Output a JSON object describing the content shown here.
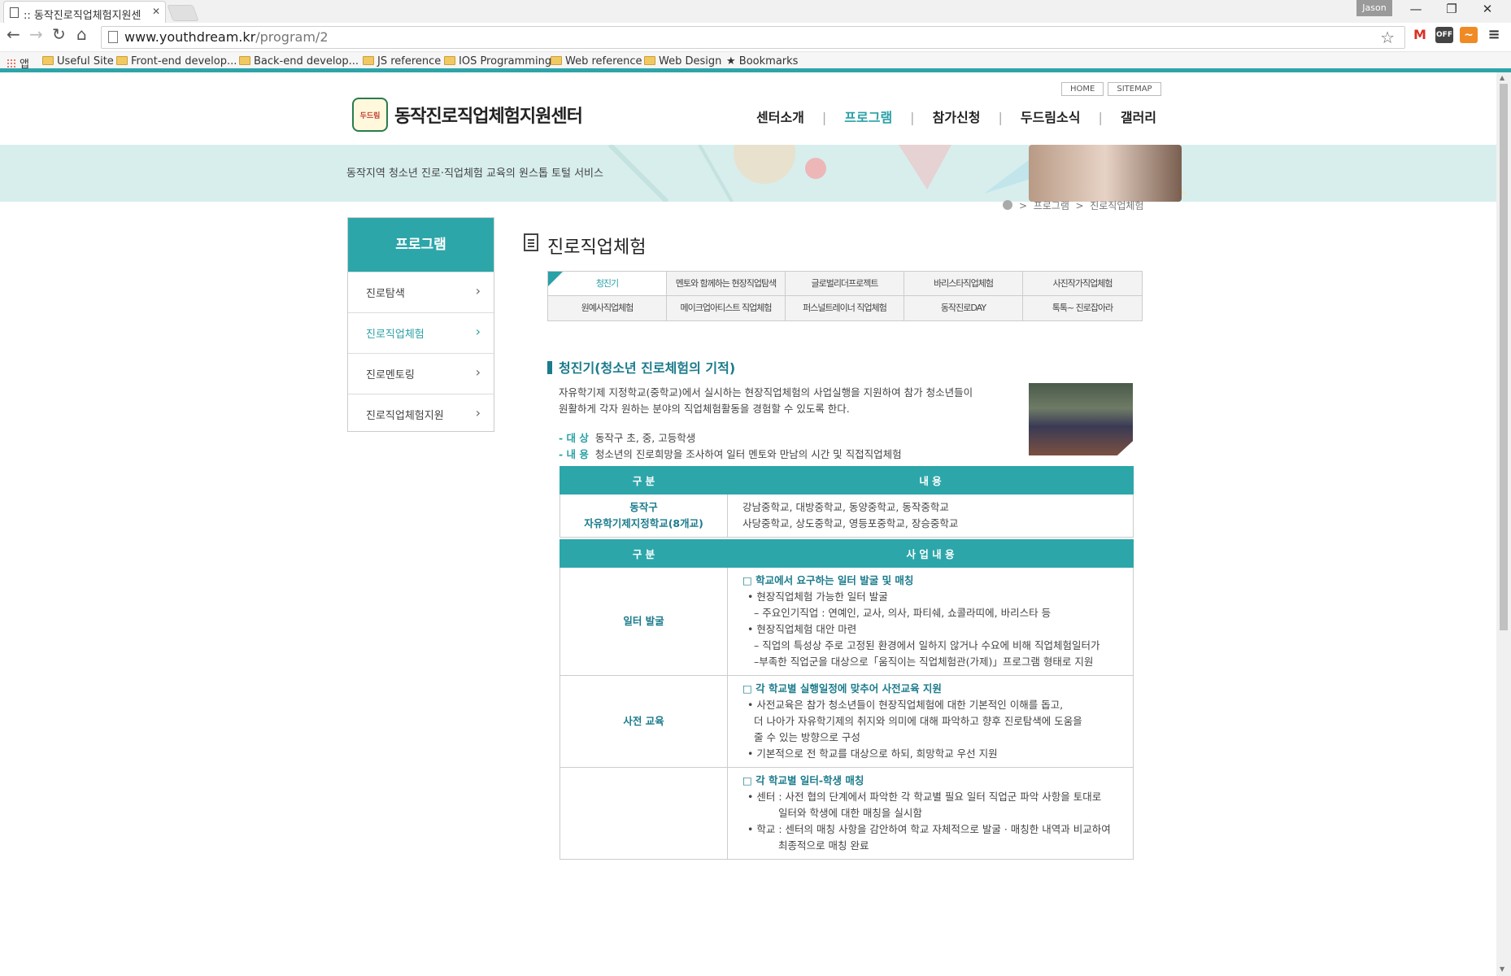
{
  "browser": {
    "tab_title": ":: 동작진로직업체험지원센",
    "tab_close": "✕",
    "user_label": "Jason",
    "url_host": "www.youthdream.kr",
    "url_path": "/program/2",
    "bookmarks": [
      "앱",
      "Useful Site",
      "Front-end develop...",
      "Back-end develop...",
      "JS reference",
      "IOS Programming",
      "Web reference",
      "Web Design",
      "Bookmarks"
    ],
    "ext_off_label": "OFF"
  },
  "site": {
    "util": [
      "HOME",
      "SITEMAP"
    ],
    "logo_text": "두드림",
    "title": "동작진로직업체험지원센터",
    "gnb": [
      "센터소개",
      "프로그램",
      "참가신청",
      "두드림소식",
      "갤러리"
    ],
    "gnb_active_index": 1,
    "slogan": "동작지역 청소년 진로·직업체험 교육의 원스톱 토털 서비스",
    "breadcrumb": [
      "프로그램",
      "진로직업체험"
    ],
    "breadcrumb_sep": ">",
    "lnb_title": "프로그램",
    "lnb": [
      "진로탐색",
      "진로직업체험",
      "진로멘토링",
      "진로직업체험지원"
    ],
    "lnb_active_index": 1,
    "content_title": "진로직업체험",
    "tabs_row1": [
      "청진기",
      "멘토와 함께하는 현장직업탐색",
      "글로벌리더프로젝트",
      "바리스타직업체험",
      "사진작가직업체험"
    ],
    "tabs_row2": [
      "원예사직업체험",
      "메이크업아티스트 직업체험",
      "퍼스널트레이너 직업체험",
      "동작진로DAY",
      "톡톡~ 진로잡아라"
    ],
    "section_title": "청진기(청소년 진로체험의 기적)",
    "intro_1": "자유학기제 지정학교(중학교)에서 실시하는 현장직업체험의 사업실행을 지원하여 참가 청소년들이",
    "intro_2": "원활하게 각자 원하는 분야의 직업체험활동을 경험할 수 있도록 한다.",
    "target_label": "- 대  상",
    "target_value": "동작구 초, 중, 고등학생",
    "content_label": "- 내  용",
    "content_value": "청소년의 진로희망을 조사하여 일터 멘토와 만남의 시간 및 직접직업체험",
    "table1": {
      "headers": [
        "구  분",
        "내  용"
      ],
      "left": [
        "동작구",
        "자유학기제지정학교(8개교)"
      ],
      "right": [
        "강남중학교, 대방중학교, 동양중학교, 동작중학교",
        "사당중학교, 상도중학교, 영등포중학교, 장승중학교"
      ]
    },
    "table2": {
      "headers": [
        "구  분",
        "사 업 내 용"
      ],
      "rows": [
        {
          "label": "일터 발굴",
          "lines": [
            "□ 학교에서 요구하는 일터 발굴 및 매칭",
            "• 현장직업체험 가능한 일터 발굴",
            "– 주요인기직업 : 연예인, 교사, 의사, 파티쉐, 쇼콜라띠에, 바리스타 등",
            "• 현장직업체험 대안 마련",
            "– 직업의 특성상 주로 고정된 환경에서 일하지 않거나 수요에 비해 직업체험일터가",
            "–부족한 직업군을 대상으로「움직이는 직업체험관(가제)」프로그램 형태로 지원"
          ]
        },
        {
          "label": "사전 교육",
          "lines": [
            "□ 각 학교별 실행일정에 맞추어 사전교육 지원",
            "• 사전교육은 참가 청소년들이 현장직업체험에 대한 기본적인 이해를 돕고,",
            "더 나아가 자유학기제의 취지와 의미에 대해 파악하고 향후 진로탐색에 도움을",
            "줄 수 있는 방향으로 구성",
            "• 기본적으로 전 학교를 대상으로 하되, 희망학교 우선 지원"
          ]
        },
        {
          "label": "",
          "lines": [
            "□ 각 학교별 일터-학생 매칭",
            "• 센터 : 사전 협의 단계에서 파악한 각 학교별 필요 일터 직업군 파악 사항을 토대로",
            "일터와 학생에 대한 매칭을 실시함",
            "• 학교 : 센터의 매칭 사항을 감안하여 학교 자체적으로 발굴 · 매칭한 내역과 비교하여",
            "최종적으로 매칭 완료"
          ]
        }
      ]
    }
  },
  "colors": {
    "brand_teal": "#2da6aa",
    "dark_teal": "#1b7b8c",
    "banner_bg": "#d7eeed"
  }
}
